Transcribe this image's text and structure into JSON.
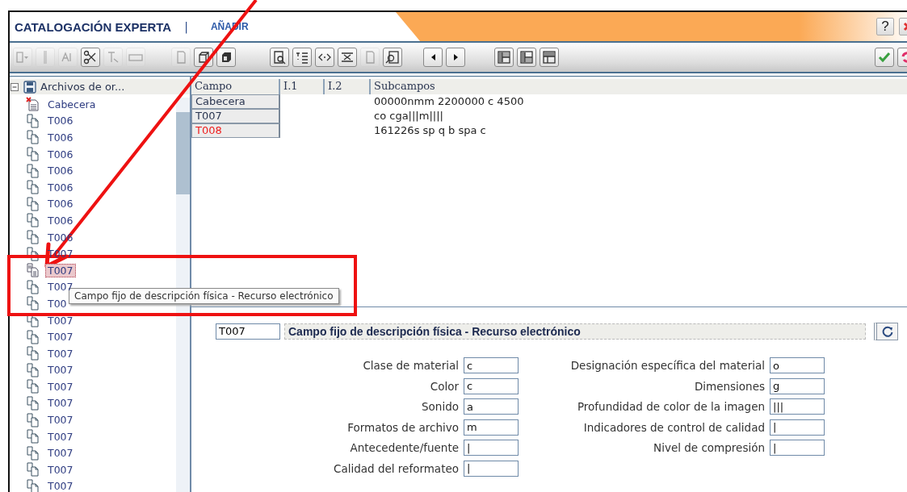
{
  "window": {
    "title": "CATALOGACIÓN EXPERTA",
    "separator": "|",
    "mode": "AÑADIR",
    "help": "?"
  },
  "toolbar": {
    "groups": [
      [
        {
          "kind": "dropdown",
          "disabled": true
        },
        {
          "kind": "bar",
          "disabled": true
        },
        {
          "kind": "letters",
          "disabled": true
        },
        {
          "kind": "scissors",
          "disabled": false
        },
        {
          "kind": "cursor",
          "disabled": true
        },
        {
          "kind": "tag",
          "disabled": true
        }
      ],
      [
        {
          "kind": "page",
          "disabled": true
        },
        {
          "kind": "cube",
          "disabled": false
        },
        {
          "kind": "cube-dark",
          "disabled": false
        }
      ],
      [
        {
          "kind": "preview",
          "disabled": false
        },
        {
          "kind": "list",
          "disabled": false
        },
        {
          "kind": "code",
          "disabled": false
        },
        {
          "kind": "delete",
          "disabled": false
        },
        {
          "kind": "page",
          "disabled": true
        },
        {
          "kind": "search",
          "disabled": false
        }
      ],
      [
        {
          "kind": "prev",
          "disabled": false
        },
        {
          "kind": "next",
          "disabled": false
        }
      ],
      [
        {
          "kind": "layout-a",
          "disabled": false
        },
        {
          "kind": "layout-b",
          "disabled": false
        },
        {
          "kind": "layout-c",
          "disabled": false
        }
      ]
    ],
    "right": [
      {
        "kind": "accept",
        "disabled": false
      },
      {
        "kind": "refresh",
        "disabled": false
      }
    ]
  },
  "tree": {
    "label": "Archivos de or...",
    "expanded": true,
    "children": [
      {
        "label": "Cabecera",
        "kind": "header",
        "selected": false
      },
      {
        "label": "T006",
        "kind": "field",
        "selected": false
      },
      {
        "label": "T006",
        "kind": "field",
        "selected": false
      },
      {
        "label": "T006",
        "kind": "field",
        "selected": false
      },
      {
        "label": "T006",
        "kind": "field",
        "selected": false
      },
      {
        "label": "T006",
        "kind": "field",
        "selected": false
      },
      {
        "label": "T006",
        "kind": "field",
        "selected": false
      },
      {
        "label": "T006",
        "kind": "field",
        "selected": false
      },
      {
        "label": "T006",
        "kind": "field",
        "selected": false
      },
      {
        "label": "T007",
        "kind": "field",
        "selected": false
      },
      {
        "label": "T007",
        "kind": "field",
        "selected": true
      },
      {
        "label": "T007",
        "kind": "field",
        "selected": false
      },
      {
        "label": "T00",
        "kind": "field",
        "selected": false
      },
      {
        "label": "T007",
        "kind": "field",
        "selected": false
      },
      {
        "label": "T007",
        "kind": "field",
        "selected": false
      },
      {
        "label": "T007",
        "kind": "field",
        "selected": false
      },
      {
        "label": "T007",
        "kind": "field",
        "selected": false
      },
      {
        "label": "T007",
        "kind": "field",
        "selected": false
      },
      {
        "label": "T007",
        "kind": "field",
        "selected": false
      },
      {
        "label": "T007",
        "kind": "field",
        "selected": false
      },
      {
        "label": "T007",
        "kind": "field",
        "selected": false
      },
      {
        "label": "T007",
        "kind": "field",
        "selected": false
      },
      {
        "label": "T007",
        "kind": "field",
        "selected": false
      },
      {
        "label": "T007",
        "kind": "field",
        "selected": false
      }
    ]
  },
  "grid": {
    "columns": [
      "Campo",
      "I.1",
      "I.2",
      "Subcampos"
    ],
    "rows": [
      {
        "campo": "Cabecera",
        "subcampos": "00000nmm 2200000 c 4500",
        "invalid": false
      },
      {
        "campo": "T007",
        "subcampos": "co cga|||m||||",
        "invalid": false
      },
      {
        "campo": "T008",
        "subcampos": "161226s sp q b spa c",
        "invalid": true
      }
    ]
  },
  "tooltip": "Campo fijo de descripción física - Recurso electrónico",
  "detail": {
    "code": "T007",
    "title": "Campo fijo de descripción física - Recurso electrónico",
    "fields_left": [
      {
        "label": "Clase de material",
        "value": "c"
      },
      {
        "label": "Color",
        "value": "c"
      },
      {
        "label": "Sonido",
        "value": "a"
      },
      {
        "label": "Formatos de archivo",
        "value": "m"
      },
      {
        "label": "Antecedente/fuente",
        "value": "|"
      },
      {
        "label": "Calidad del reformateo",
        "value": "|"
      }
    ],
    "fields_right": [
      {
        "label": "Designación específica del material",
        "value": "o"
      },
      {
        "label": "Dimensiones",
        "value": "g"
      },
      {
        "label": "Profundidad de color de la imagen",
        "value": "|||"
      },
      {
        "label": "Indicadores de control de calidad",
        "value": "|"
      },
      {
        "label": "Nivel de compresión",
        "value": "|"
      }
    ]
  }
}
